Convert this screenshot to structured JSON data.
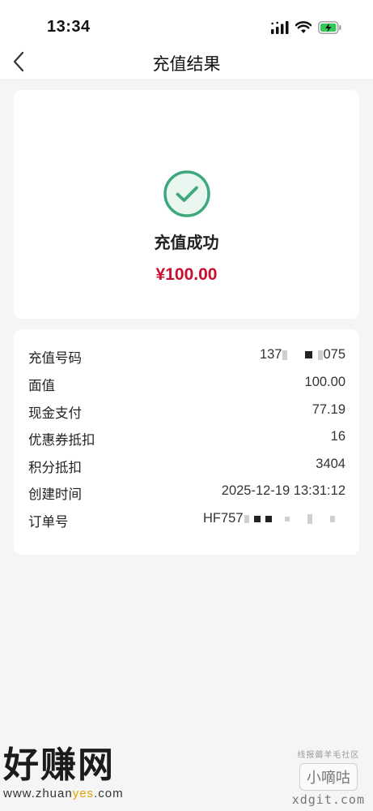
{
  "status_bar": {
    "time": "13:34"
  },
  "nav": {
    "title": "充值结果"
  },
  "result": {
    "status_text": "充值成功",
    "amount": "¥100.00"
  },
  "details": [
    {
      "label": "充值号码",
      "value_prefix": "137",
      "value_suffix": "075"
    },
    {
      "label": "面值",
      "value": "100.00"
    },
    {
      "label": "现金支付",
      "value": "77.19"
    },
    {
      "label": "优惠券抵扣",
      "value": "16"
    },
    {
      "label": "积分抵扣",
      "value": "3404"
    },
    {
      "label": "创建时间",
      "value": "2025-12-19 13:31:12"
    },
    {
      "label": "订单号",
      "value_prefix": "HF757"
    }
  ],
  "watermark": {
    "left_title": "好赚网",
    "left_url_a": "www.zhuan",
    "left_url_b": "yes",
    "left_url_c": ".com",
    "right_small": "线报薅羊毛社区",
    "right_badge": "小嘀咕",
    "right_domain": "xdgit.com"
  },
  "colors": {
    "accent_red": "#c8102e",
    "success_green": "#3fa77e"
  }
}
